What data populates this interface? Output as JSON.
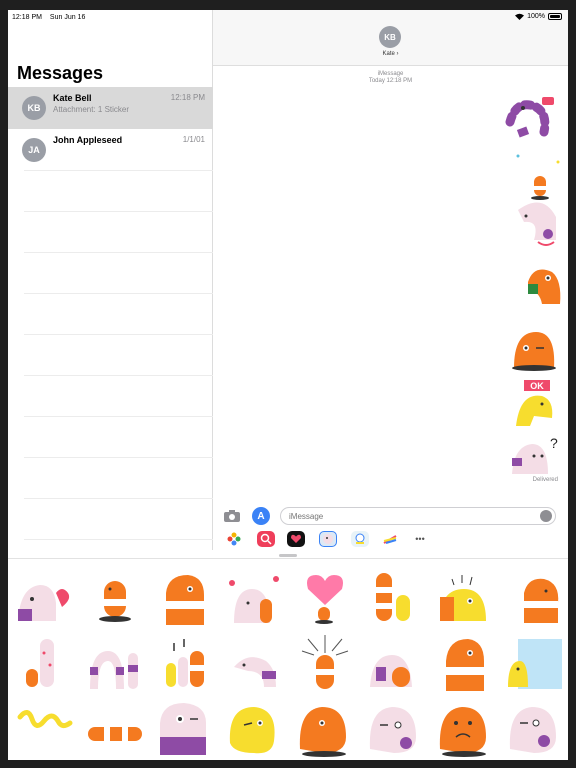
{
  "status": {
    "time": "12:18 PM",
    "date": "Sun Jun 16",
    "battery": "100%"
  },
  "sidebar": {
    "title": "Messages",
    "conversations": [
      {
        "initials": "KB",
        "name": "Kate Bell",
        "preview": "Attachment: 1 Sticker",
        "time": "12:18 PM",
        "selected": true
      },
      {
        "initials": "JA",
        "name": "John Appleseed",
        "preview": "",
        "time": "1/1/01",
        "selected": false
      }
    ]
  },
  "chat": {
    "contact_initials": "KB",
    "contact_name": "Kate ›",
    "service": "iMessage",
    "timestamp": "Today 12:18 PM",
    "delivered": "Delivered",
    "input_placeholder": "iMessage",
    "ok_label": "OK",
    "question_mark": "?"
  },
  "apps": [
    "photos-app-icon",
    "image-search-app-icon",
    "heart-sticker-app-icon",
    "worm-sticker-app-icon",
    "character-app-icon",
    "rainbow-app-icon",
    "more-apps-icon"
  ],
  "colors": {
    "orange": "#f47a20",
    "purple": "#8e4ba5",
    "pink": "#ef4a6b",
    "yellow": "#f7dd2e",
    "blue": "#3a82f6"
  }
}
